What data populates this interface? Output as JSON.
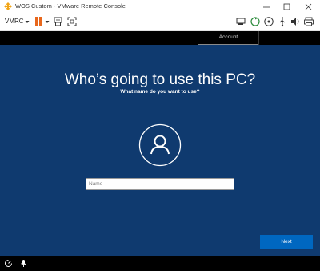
{
  "window": {
    "title": "WOS Custom - VMware Remote Console",
    "buttons": {
      "minimize_icon": "minimize-icon",
      "maximize_icon": "maximize-icon",
      "close_icon": "close-icon"
    }
  },
  "toolbar": {
    "vmrc_label": "VMRC",
    "icons": [
      "power-pause-icon",
      "send-keys-icon",
      "fullscreen-icon",
      "network-icon",
      "disk-sync-icon",
      "cd-icon",
      "usb-icon",
      "sound-icon",
      "printer-icon",
      "settings-icon"
    ],
    "colors": {
      "pause": "#e8671c"
    }
  },
  "tabs": [
    {
      "label": "Account"
    }
  ],
  "oobe": {
    "heading": "Who’s going to use this PC?",
    "subheading": "What name do you want to use?",
    "name_placeholder": "Name",
    "next_label": "Next",
    "colors": {
      "background": "#0f3a6f",
      "accent": "#0067c0"
    }
  },
  "bottom_bar": {
    "icons": [
      "ease-of-access-icon",
      "microphone-icon"
    ]
  }
}
